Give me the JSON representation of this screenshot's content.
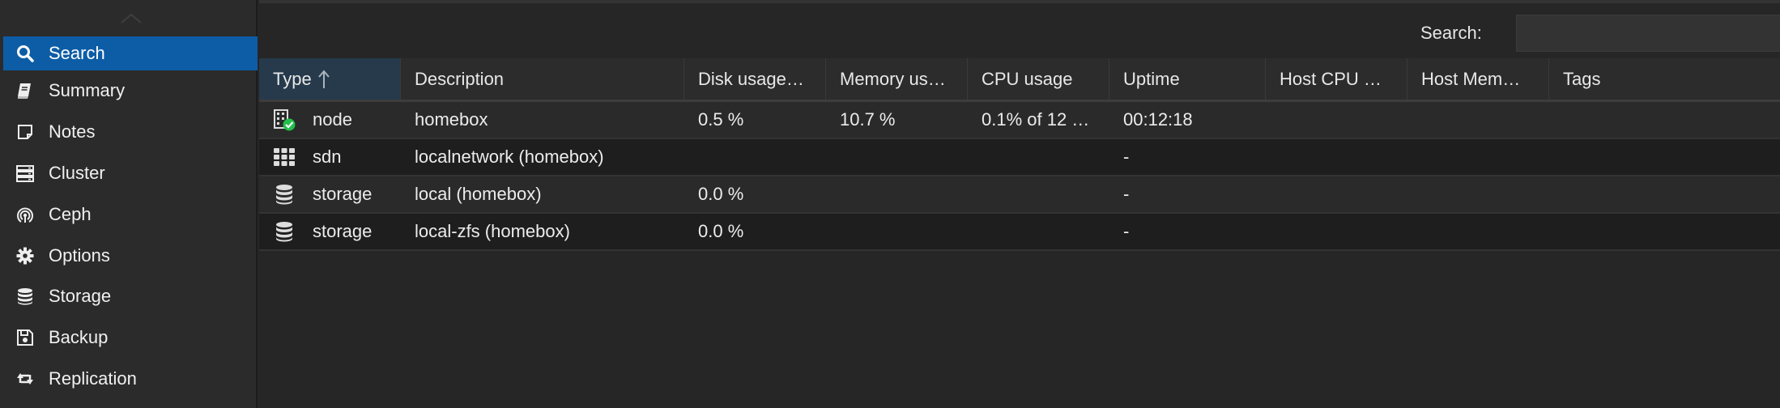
{
  "sidebar": {
    "items": [
      {
        "label": "Search",
        "icon": "search-icon",
        "active": true
      },
      {
        "label": "Summary",
        "icon": "book-icon"
      },
      {
        "label": "Notes",
        "icon": "sticky-note-icon"
      },
      {
        "label": "Cluster",
        "icon": "server-icon"
      },
      {
        "label": "Ceph",
        "icon": "ceph-icon"
      },
      {
        "label": "Options",
        "icon": "gear-icon"
      },
      {
        "label": "Storage",
        "icon": "database-icon"
      },
      {
        "label": "Backup",
        "icon": "floppy-icon"
      },
      {
        "label": "Replication",
        "icon": "retweet-icon"
      }
    ]
  },
  "toolbar": {
    "search_label": "Search:",
    "search_value": ""
  },
  "grid": {
    "columns": [
      "Type",
      "Description",
      "Disk usage…",
      "Memory us…",
      "CPU usage",
      "Uptime",
      "Host CPU …",
      "Host Mem…",
      "Tags"
    ],
    "sorted_column": "Type",
    "rows": [
      {
        "type": "node",
        "icon": "node-online-icon",
        "description": "homebox",
        "disk": "0.5 %",
        "memory": "10.7 %",
        "cpu": "0.1% of 12 …",
        "uptime": "00:12:18",
        "host_cpu": "",
        "host_mem": "",
        "tags": ""
      },
      {
        "type": "sdn",
        "icon": "sdn-grid-icon",
        "description": "localnetwork (homebox)",
        "disk": "",
        "memory": "",
        "cpu": "",
        "uptime": "-",
        "host_cpu": "",
        "host_mem": "",
        "tags": ""
      },
      {
        "type": "storage",
        "icon": "database-icon",
        "description": "local (homebox)",
        "disk": "0.0 %",
        "memory": "",
        "cpu": "",
        "uptime": "-",
        "host_cpu": "",
        "host_mem": "",
        "tags": ""
      },
      {
        "type": "storage",
        "icon": "database-icon",
        "description": "local-zfs (homebox)",
        "disk": "0.0 %",
        "memory": "",
        "cpu": "",
        "uptime": "-",
        "host_cpu": "",
        "host_mem": "",
        "tags": ""
      }
    ]
  },
  "colors": {
    "accent": "#0d5da6",
    "online": "#21bf4b"
  }
}
